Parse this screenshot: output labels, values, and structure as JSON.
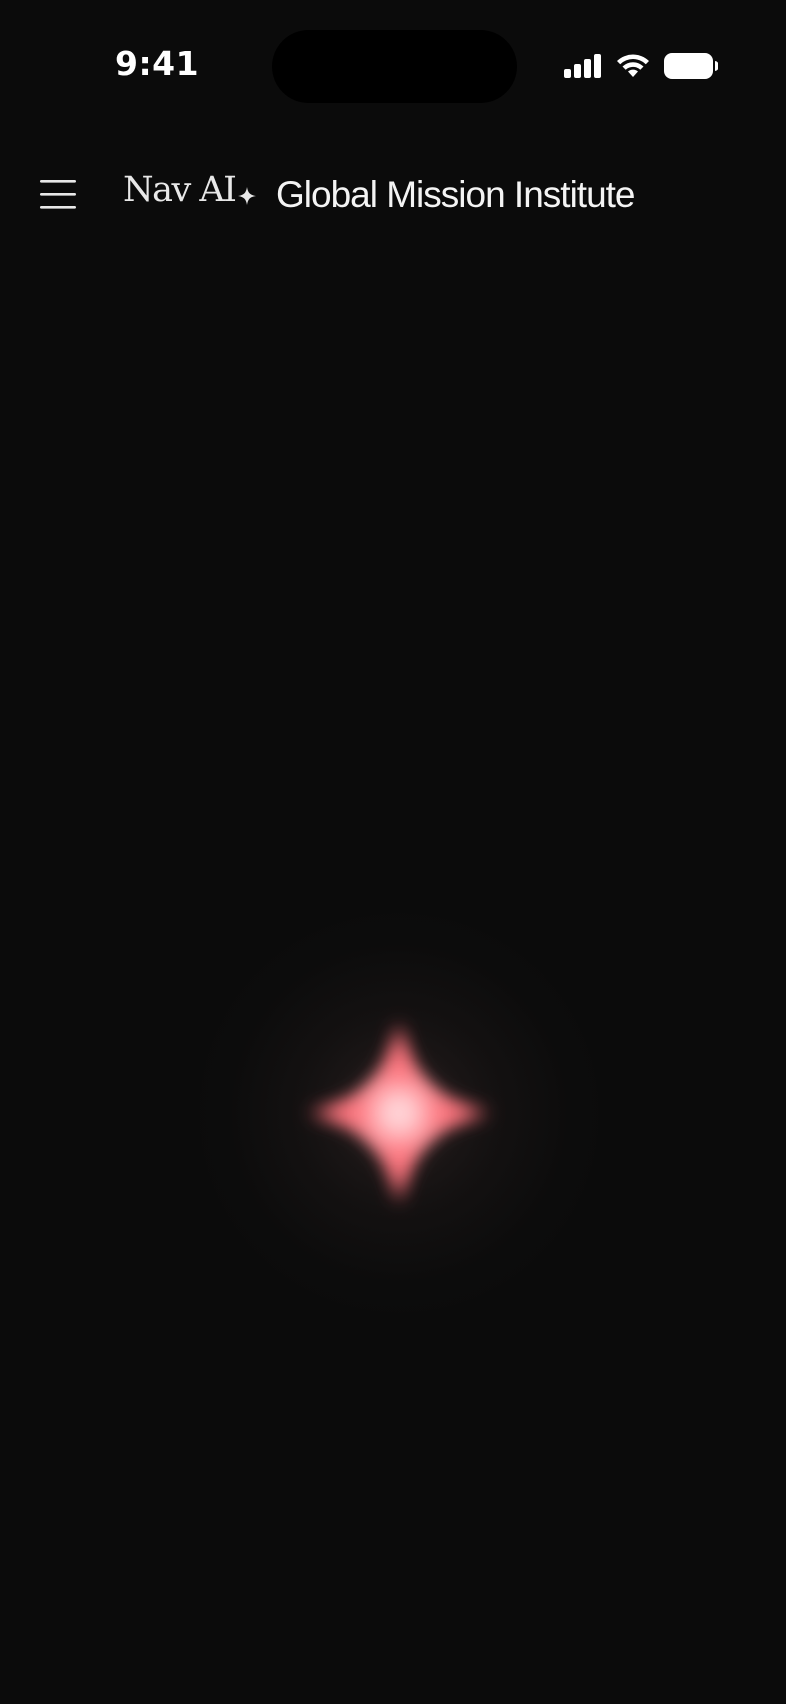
{
  "status_bar": {
    "time": "9:41",
    "icons": [
      "cellular-signal-icon",
      "wifi-icon",
      "battery-icon"
    ]
  },
  "header": {
    "menu_icon": "hamburger-menu-icon",
    "brand": "Nav AI",
    "separator_icon": "four-point-star-icon",
    "organization": "Global Mission Institute"
  },
  "assistant": {
    "orb_icon": "four-point-star-glow-icon",
    "accent_color": "#ff6b74"
  },
  "colors": {
    "background": "#0b0b0b",
    "text": "#f2f2f2"
  }
}
